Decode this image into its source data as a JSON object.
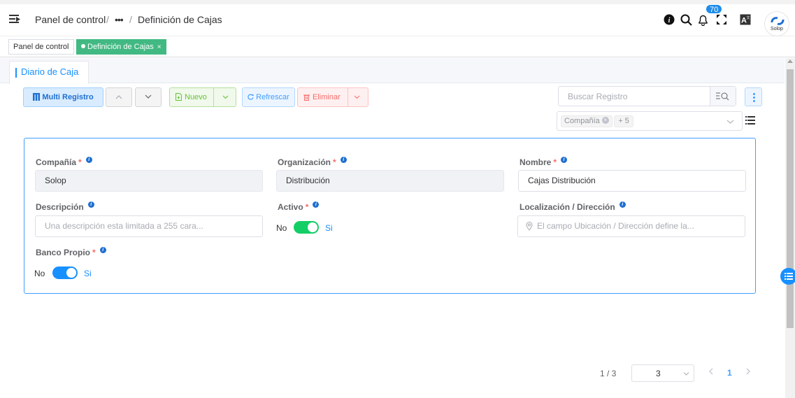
{
  "header": {
    "breadcrumb": [
      "Panel de control",
      "•••",
      "Definición de Cajas"
    ],
    "separator": "/",
    "notifications_count": "70",
    "logo_text": "Solop"
  },
  "tagbar": {
    "tags": [
      {
        "label": "Panel de control",
        "active": false
      },
      {
        "label": "Definición de Cajas",
        "active": true,
        "close": "×"
      }
    ]
  },
  "tabs": [
    {
      "label": "Diario de Caja",
      "active": true
    }
  ],
  "toolbar": {
    "multi_label": "Multi Registro",
    "new_label": "Nuevo",
    "refresh_label": "Refrescar",
    "delete_label": "Eliminar"
  },
  "search": {
    "placeholder": "Buscar Registro"
  },
  "columns_selector": {
    "chip": "Compañía",
    "more": "+ 5"
  },
  "form": {
    "fields": {
      "company": {
        "label": "Compañía",
        "value": "Solop",
        "required": true
      },
      "organization": {
        "label": "Organización",
        "value": "Distribución",
        "required": true
      },
      "name": {
        "label": "Nombre",
        "value": "Cajas Distribución",
        "required": true
      },
      "description": {
        "label": "Descripción",
        "placeholder": "Una descripción esta limitada a 255 cara..."
      },
      "active": {
        "label": "Activo",
        "required": true,
        "off_label": "No",
        "on_label": "Si",
        "value": true
      },
      "location": {
        "label": "Localización / Dirección",
        "placeholder": "El campo Ubicación / Dirección define la..."
      },
      "own_bank": {
        "label": "Banco Propio",
        "required": true,
        "off_label": "No",
        "on_label": "Si",
        "value": true
      }
    },
    "required_mark": "*",
    "info_mark": "i"
  },
  "pagination": {
    "count": "1 / 3",
    "page_size": "3",
    "current_page": "1"
  },
  "colors": {
    "accent": "#409eff",
    "active_tag": "#42b983",
    "switch_green": "#13ce66",
    "switch_blue": "#1890ff",
    "danger": "#f56c6c"
  }
}
